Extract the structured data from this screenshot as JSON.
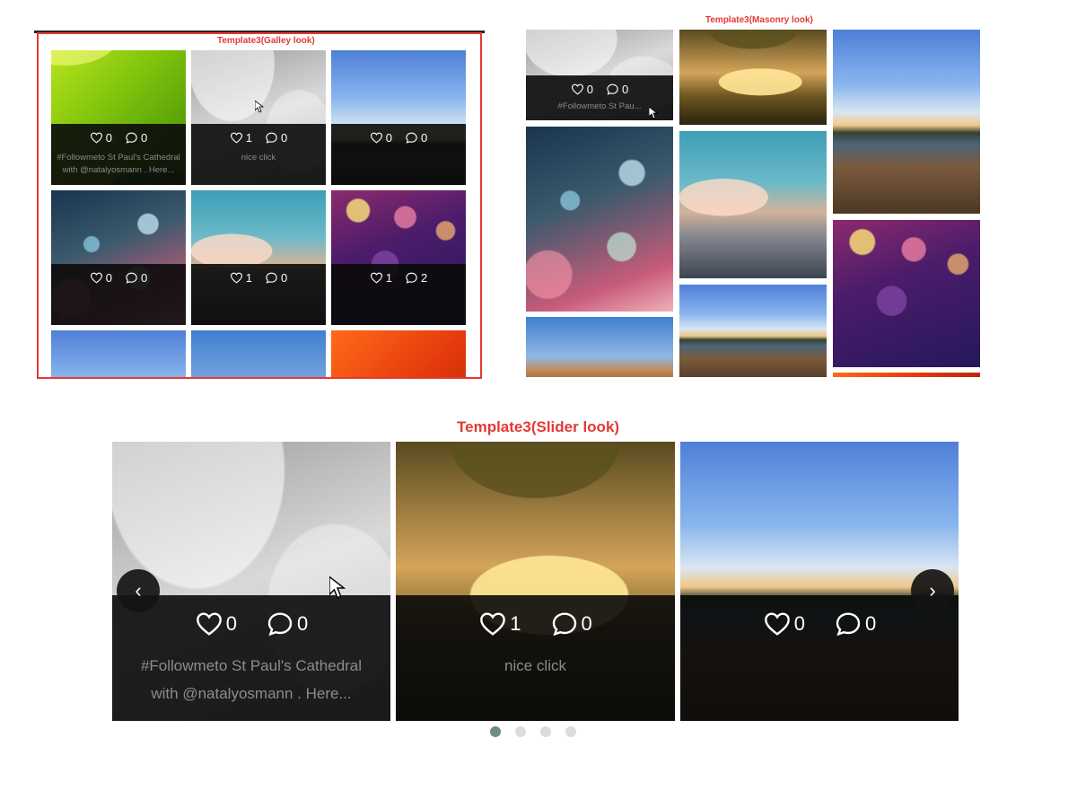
{
  "labels": {
    "gallery": "Template3(Galley look)",
    "masonry": "Template3(Masonry look)",
    "slider": "Template3(Slider look)"
  },
  "gallery": {
    "tiles": [
      {
        "photo": "green-abstract",
        "likes": "0",
        "comments": "0",
        "caption": "#Followmeto St Paul's Cathedral with @natalyosmann . Here..."
      },
      {
        "photo": "tree-lake-bw",
        "likes": "1",
        "comments": "0",
        "caption": "nice click"
      },
      {
        "photo": "sky-pier",
        "likes": "0",
        "comments": "0",
        "caption": ""
      },
      {
        "photo": "bubbles",
        "likes": "0",
        "comments": "0",
        "caption": ""
      },
      {
        "photo": "city-blur",
        "likes": "1",
        "comments": "0",
        "caption": ""
      },
      {
        "photo": "bokeh",
        "likes": "1",
        "comments": "2",
        "caption": ""
      },
      {
        "photo": "sky",
        "likes": "",
        "comments": "",
        "caption": ""
      },
      {
        "photo": "desert",
        "likes": "",
        "comments": "",
        "caption": ""
      },
      {
        "photo": "petals",
        "likes": "",
        "comments": "",
        "caption": ""
      }
    ]
  },
  "masonry": {
    "first": {
      "likes": "0",
      "comments": "0",
      "caption": "#Followmeto St Pau..."
    }
  },
  "slider": {
    "slides": [
      {
        "photo": "gray-abstract",
        "likes": "0",
        "comments": "0",
        "caption1": "#Followmeto St Paul's Cathedral",
        "caption2": "with @natalyosmann . Here..."
      },
      {
        "photo": "forest-sunset",
        "likes": "1",
        "comments": "0",
        "caption1": "nice click",
        "caption2": ""
      },
      {
        "photo": "sky-pier",
        "likes": "0",
        "comments": "0",
        "caption1": "",
        "caption2": ""
      }
    ],
    "prev_glyph": "‹",
    "next_glyph": "›",
    "dots": 4,
    "active_dot": 0
  }
}
